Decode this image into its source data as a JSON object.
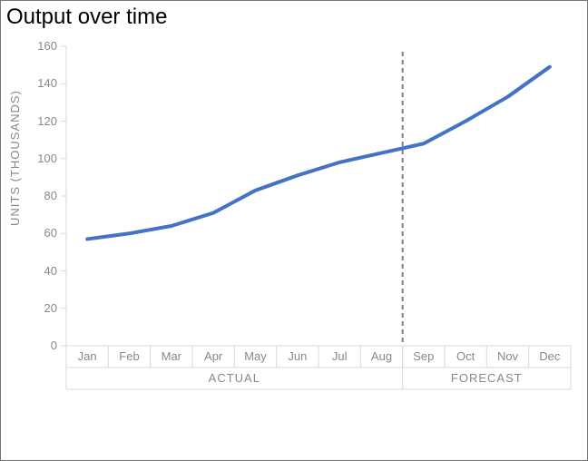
{
  "chart_data": {
    "type": "line",
    "title": "Output over time",
    "ylabel": "UNITS (THOUSANDS)",
    "xlabel": "",
    "categories": [
      "Jan",
      "Feb",
      "Mar",
      "Apr",
      "May",
      "Jun",
      "Jul",
      "Aug",
      "Sep",
      "Oct",
      "Nov",
      "Dec"
    ],
    "values": [
      57,
      60,
      64,
      71,
      83,
      91,
      98,
      103,
      108,
      120,
      133,
      149
    ],
    "ylim": [
      0,
      160
    ],
    "y_ticks": [
      0,
      20,
      40,
      60,
      80,
      100,
      120,
      140,
      160
    ],
    "x_category_groups": [
      {
        "label": "ACTUAL",
        "from": "Jan",
        "to": "Aug"
      },
      {
        "label": "FORECAST",
        "from": "Sep",
        "to": "Dec"
      }
    ],
    "forecast_divider_before": "Sep",
    "series_color": "#4472C4",
    "grid_color": "#D9D9D9",
    "divider_color": "#7F7F7F"
  }
}
